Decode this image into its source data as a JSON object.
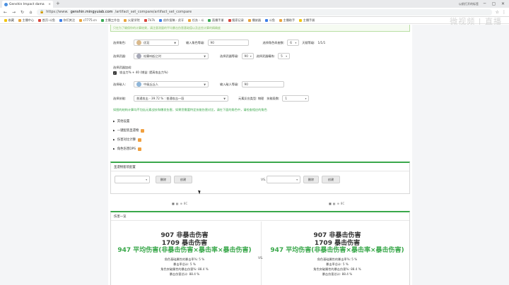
{
  "browser": {
    "tab_title": "Genshin Impact dama",
    "new_tab": "+",
    "window_controls": [
      "─",
      "▢",
      "✕"
    ],
    "side_text": "以前打开的标签",
    "url_host": "genshin.mingyuiab.com",
    "url_path": "/artifact_set_compare/artifact_set_compare",
    "url_scheme": "https://www.",
    "bookmarks": [
      "收藏",
      "主播中心",
      "首页-斗鱼",
      "你们关注",
      "c7775.cn",
      "主播工作台",
      "火星学院",
      "7k7k",
      "创作投稿 - 虎牙",
      "任务 - 斗",
      "直播手册",
      "搜索记录",
      "播放器",
      "斗鱼",
      "主播助手",
      "主播手册"
    ]
  },
  "watermark": "微视频 | 直播",
  "top_note": "只在为了确保你的计算结果，请注意测量的平均暴击伤害基础值以及这些计算的精确度",
  "form": {
    "char_label": "选择角色:",
    "char_value": "优菈",
    "char_level_label": "输入角色等级:",
    "char_level": "90",
    "constellation_label": "选择角色命座数:",
    "constellation": "6",
    "talent_label": "天赋等级:",
    "talent": "1/1/1",
    "weapon_label": "选择武器:",
    "weapon_value": "松籁响起之时",
    "weapon_level_label": "选择武器等级:",
    "weapon_level": "90",
    "refine_label": "选择武器精炼:",
    "refine": "5",
    "buff_label": "选择武器加成:",
    "buff_value": "攻击力% + 40 (增益: 提高攻击力%)",
    "enemy_label": "选择敌人:",
    "enemy_value": "中级丘丘人",
    "enemy_level_label": "输入敌人等级:",
    "enemy_level": "90",
    "skill_label": "选择技能:",
    "skill_value": "普通攻击 - 39.72 % : 普通攻击一段",
    "reaction_label": "元素反应类型: 物理",
    "hits_label": "技能段数:",
    "hits": "1"
  },
  "warning": "如图的结构计算均不包括元素战技和爆发伤害，如果您需要特定技能伤害对比，请在下面的角色中，请检查相应的角色",
  "collapsibles": [
    "其他设置",
    "一键配装圣遗物",
    "伤害对比计算",
    "角色伤害DPS"
  ],
  "compare": {
    "title": "圣遗物套装配置",
    "delete_label": "删除",
    "create_label": "创建",
    "vs": "VS.",
    "mini_icons": [
      "■",
      "▦",
      "⊕",
      "8C"
    ]
  },
  "result": {
    "title": "伤害一览",
    "vs": "VS.",
    "columns": [
      {
        "non_crit": "907 非暴击伤害",
        "crit": "1709 暴击伤害",
        "avg": "947 平均伤害(非暴击伤害×暴击率×暴击伤害)",
        "lines": [
          "角色基础属性的暴击率%: 5 %",
          "暴击率总计: 5 %",
          "角色突破属性的暴击伤害%: 88.4 %",
          "暴击伤害总计: 88.4 %"
        ]
      },
      {
        "non_crit": "907 非暴击伤害",
        "crit": "1709 暴击伤害",
        "avg": "947 平均伤害(非暴击伤害×暴击率×暴击伤害)",
        "lines": [
          "角色基础属性的暴击率%: 5 %",
          "暴击率总计: 5 %",
          "角色突破属性的暴击伤害%: 88.4 %",
          "暴击伤害总计: 88.4 %"
        ]
      }
    ]
  }
}
